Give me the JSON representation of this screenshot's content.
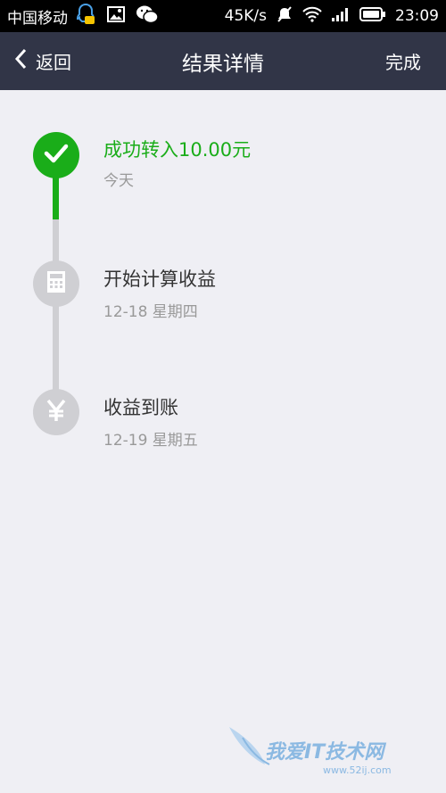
{
  "status_bar": {
    "carrier": "中国移动",
    "speed": "45K/s",
    "time": "23:09"
  },
  "nav": {
    "back_label": "返回",
    "title": "结果详情",
    "done_label": "完成"
  },
  "steps": [
    {
      "title": "成功转入10.00元",
      "sub": "今天",
      "status": "done",
      "icon": "check-icon"
    },
    {
      "title": "开始计算收益",
      "sub": "12-18 星期四",
      "status": "pending",
      "icon": "calculator-icon"
    },
    {
      "title": "收益到账",
      "sub": "12-19 星期五",
      "status": "pending",
      "icon": "yen-icon"
    }
  ],
  "watermark": {
    "text": "我爱IT技术网",
    "url": "www.52ij.com"
  },
  "colors": {
    "nav_bg": "#313547",
    "accent_green": "#1aad19",
    "pending_gray": "#cfcfd3",
    "page_bg": "#efeff4"
  }
}
